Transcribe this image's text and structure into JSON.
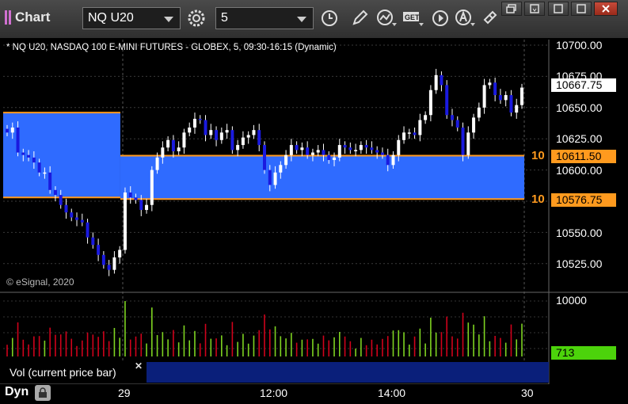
{
  "toolbar": {
    "title": "Chart",
    "symbol": "NQ U20",
    "interval": "5",
    "icons": [
      "settings-gear-icon",
      "clock-icon",
      "pencil-icon",
      "study-icon",
      "get-icon",
      "play-icon",
      "alert-icon",
      "link-icon"
    ]
  },
  "window": {
    "buttons": [
      "restore-icon",
      "maximize-icon",
      "minimize-icon",
      "close-icon"
    ]
  },
  "chart": {
    "description": "* NQ U20, NASDAQ 100 E-MINI FUTURES - GLOBEX, 5, 09:30-16:15 (Dynamic)",
    "copyright": "© eSignal, 2020",
    "colors": {
      "zone_fill": "#2f6bff",
      "zone_border": "#ff9a1e",
      "up_candle": "#ffffff",
      "down_candle": "#1a1adf",
      "volume_up": "#7ed321",
      "volume_down": "#d0021b",
      "current_price_tag": "#ffffff",
      "volume_tag": "#4cd30b"
    },
    "chart_data": {
      "type": "candlestick",
      "y_ticks": [
        "10700.00",
        "10675.00",
        "10650.00",
        "10625.00",
        "10600.00",
        "10550.00",
        "10525.00"
      ],
      "ylim": [
        10505,
        10710
      ],
      "current_price": "10667.75",
      "levels": [
        {
          "label": "10",
          "value": "10611.50"
        },
        {
          "label": "10",
          "value": "10576.75"
        }
      ],
      "zones": [
        {
          "from_bar": 0,
          "to_bar": 22,
          "high": 10646,
          "low": 10578
        },
        {
          "from_bar": 22,
          "to_bar": 97,
          "high": 10611.5,
          "low": 10576.75
        }
      ],
      "x_ticks": [
        "29",
        "12:00",
        "14:00",
        "30"
      ],
      "closes": [
        10630,
        10634,
        10614,
        10612,
        10610,
        10606,
        10598,
        10598,
        10584,
        10580,
        10572,
        10566,
        10562,
        10560,
        10558,
        10546,
        10540,
        10532,
        10524,
        10520,
        10530,
        10536,
        10582,
        10578,
        10576,
        10568,
        10572,
        10600,
        10610,
        10618,
        10624,
        10615,
        10618,
        10630,
        10634,
        10641,
        10640,
        10628,
        10632,
        10624,
        10630,
        10632,
        10616,
        10620,
        10626,
        10628,
        10632,
        10620,
        10600,
        10588,
        10598,
        10604,
        10612,
        10620,
        10616,
        10618,
        10612,
        10614,
        10616,
        10612,
        10608,
        10610,
        10620,
        10618,
        10616,
        10616,
        10620,
        10618,
        10616,
        10614,
        10612,
        10604,
        10612,
        10624,
        10630,
        10630,
        10628,
        10640,
        10644,
        10664,
        10676,
        10668,
        10644,
        10640,
        10634,
        10612,
        10630,
        10642,
        10650,
        10668,
        10670,
        10660,
        10656,
        10660,
        10646,
        10652,
        10666
      ],
      "volume": {
        "y_tick": "10000",
        "current": "713",
        "label": "Vol (current price bar)"
      }
    },
    "panel_label": "Dyn"
  }
}
